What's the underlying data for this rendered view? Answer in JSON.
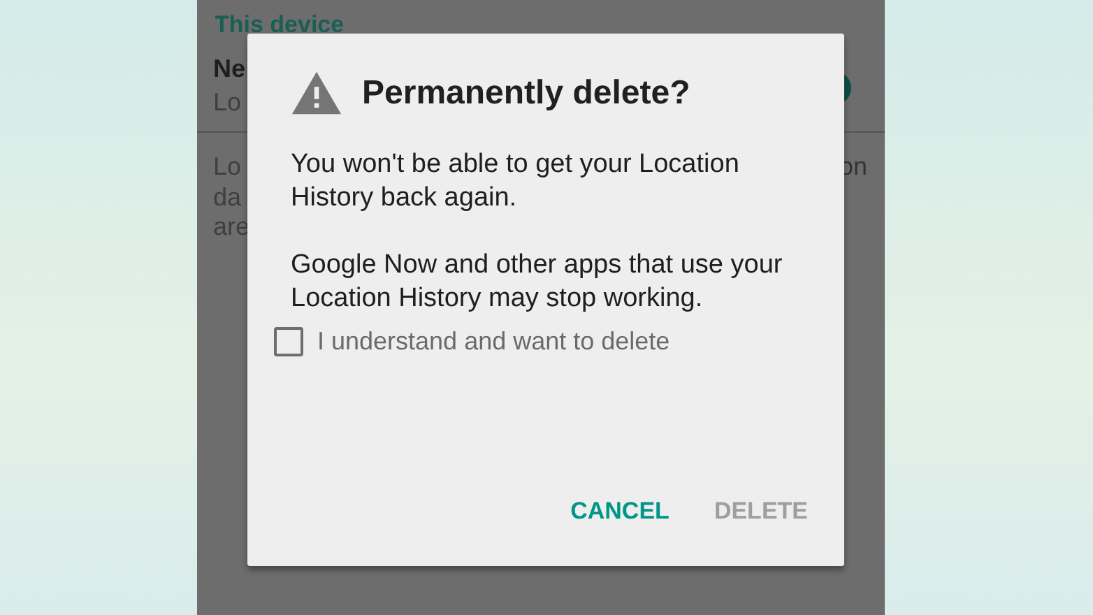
{
  "background_screen": {
    "section_heading": "This device",
    "setting_title": "Ne",
    "setting_subtitle": "Lo",
    "switch": {
      "on": true
    },
    "description_lines": [
      {
        "left": "Lo",
        "right": "on"
      },
      {
        "left": "da"
      },
      {
        "left": "are"
      }
    ]
  },
  "dialog": {
    "title": "Permanently delete?",
    "paragraphs": [
      "You won't be able to get your Location History back again.",
      "Google Now and other apps that use your Location History may stop working."
    ],
    "checkbox": {
      "label": "I understand and want to delete",
      "checked": false
    },
    "buttons": [
      {
        "label": "CANCEL",
        "disabled": false
      },
      {
        "label": "DELETE",
        "disabled": true
      }
    ]
  }
}
